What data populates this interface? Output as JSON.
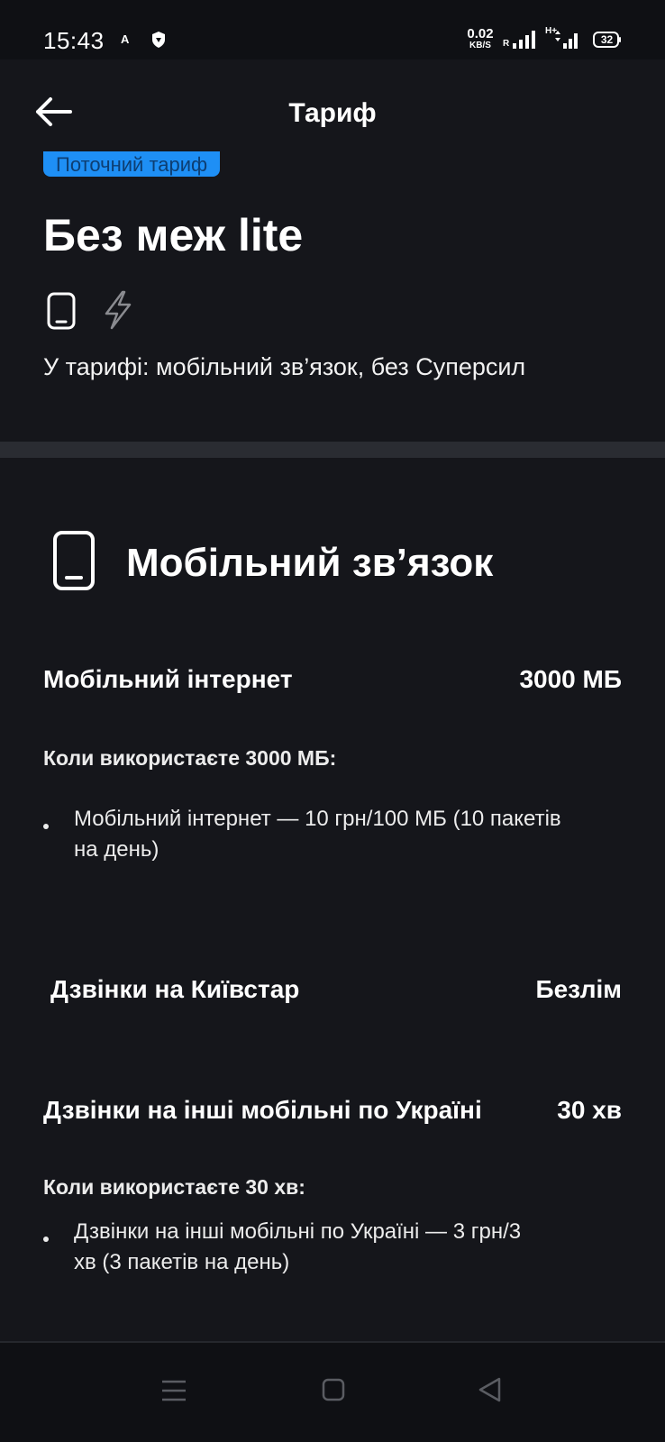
{
  "status_bar": {
    "time": "15:43",
    "notification_letter": "A",
    "net_speed_value": "0.02",
    "net_speed_unit": "KB/S",
    "roaming": "R",
    "network_type": "H+",
    "battery_level": "32"
  },
  "header": {
    "title": "Тариф"
  },
  "tariff": {
    "badge": "Поточний тариф",
    "name": "Без меж lite",
    "description": "У тарифі: мобільний зв’язок, без Суперсил"
  },
  "mobile_section": {
    "title": "Мобільний зв’язок",
    "internet": {
      "label": "Мобільний інтернет",
      "value": "3000 МБ",
      "note": "Коли використаєте 3000 МБ:",
      "bullet": "Мобільний інтернет — 10 грн/100 МБ (10 пакетів\nна день)"
    },
    "kyivstar_calls": {
      "label": "Дзвінки на Київстар",
      "value": "Безлім"
    },
    "other_calls": {
      "label": "Дзвінки на інші мобільні по Україні",
      "value": "30 хв",
      "note": "Коли використаєте 30 хв:",
      "bullet": "Дзвінки на інші мобільні по Україні — 3 грн/3\nхв (3 пакетів на день)"
    }
  },
  "colors": {
    "background": "#0f1014",
    "surface": "#15161b",
    "accent_badge": "#1e8ff5",
    "divider": "#2a2c32",
    "text": "#ffffff"
  },
  "icons": {
    "back": "arrow-left-icon",
    "tariff_features": [
      "phone-icon",
      "lightning-icon"
    ],
    "section": "phone-icon",
    "nav": [
      "menu-icon",
      "home-square-icon",
      "back-triangle-icon"
    ]
  }
}
